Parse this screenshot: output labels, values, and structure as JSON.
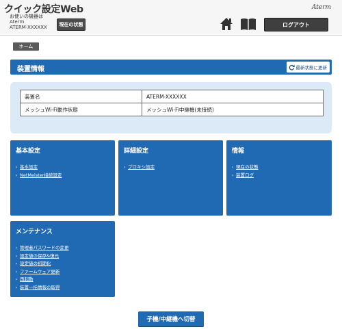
{
  "header": {
    "app_title": "クイック設定Web",
    "device_note_line1": "お使いの機器は",
    "device_note_line2": "Aterm",
    "device_note_line3": "ATERM-XXXXXX",
    "status_button": "現在の状態",
    "brand": "Aterm",
    "logout_button": "ログアウト",
    "icons": [
      "home-icon",
      "book-icon"
    ]
  },
  "breadcrumb": {
    "home": "ホーム"
  },
  "device_info": {
    "title": "装置情報",
    "refresh_label": "最新状態に更新",
    "rows": [
      {
        "key": "装置名",
        "value": "ATERM-XXXXXX"
      },
      {
        "key": "メッシュWi-Fi動作状態",
        "value": "メッシュWi-Fi中継機(未接続)"
      }
    ]
  },
  "cards": {
    "basic": {
      "title": "基本設定",
      "links": [
        "基本設定",
        "NetMeister接続設定"
      ]
    },
    "advanced": {
      "title": "詳細設定",
      "links": [
        "プロキシ設定"
      ]
    },
    "info": {
      "title": "情報",
      "links": [
        "現在の状態",
        "装置ログ"
      ]
    },
    "maintenance": {
      "title": "メンテナンス",
      "links": [
        "管理者パスワードの変更",
        "設定値の保存&復元",
        "設定値の初期化",
        "ファームウェア更新",
        "再起動",
        "装置一括情報の取得"
      ]
    }
  },
  "switch_button": "子機/中継機へ切替",
  "colors": {
    "primary": "#1f6ab3",
    "panel": "#dce9f7",
    "dark_button": "#3f3f3f"
  }
}
